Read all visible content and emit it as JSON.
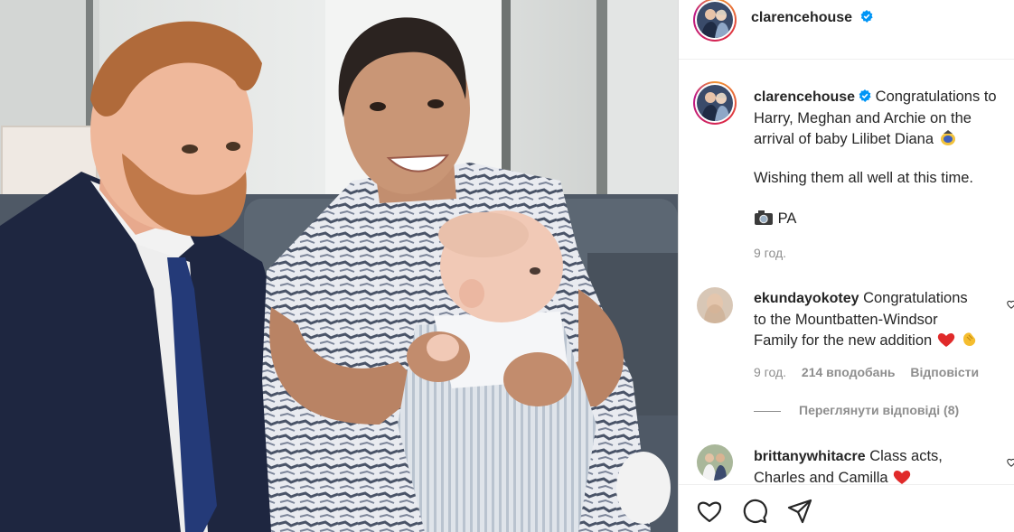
{
  "post": {
    "author": "clarencehouse",
    "verified": true
  },
  "caption": {
    "username": "clarencehouse",
    "line1": "Congratulations to",
    "line2": "Harry, Meghan and Archie on the",
    "line3": "arrival of baby Lilibet Diana",
    "line4": "Wishing them all well at this time.",
    "line5": "PA",
    "time": "9 год."
  },
  "comments": [
    {
      "username": "ekundayokotey",
      "line1": "Congratulations",
      "line2": "to the Mountbatten-Windsor",
      "line3": "Family for the new addition",
      "time": "9 год.",
      "likes": "214 вподобань",
      "reply": "Відповісти",
      "view_replies": "Переглянути відповіді (8)"
    },
    {
      "username": "brittanywhitacre",
      "line1": "Class acts,",
      "line2": "Charles and Camilla"
    }
  ],
  "icons": {
    "like": "heart-icon",
    "comment": "comment-icon",
    "share": "share-icon",
    "verified": "verified-badge-icon",
    "camera": "camera-icon"
  },
  "colors": {
    "verified_blue": "#0095f6",
    "heart_red": "#ed4956",
    "text": "#262626",
    "meta": "#8e8e8e"
  }
}
